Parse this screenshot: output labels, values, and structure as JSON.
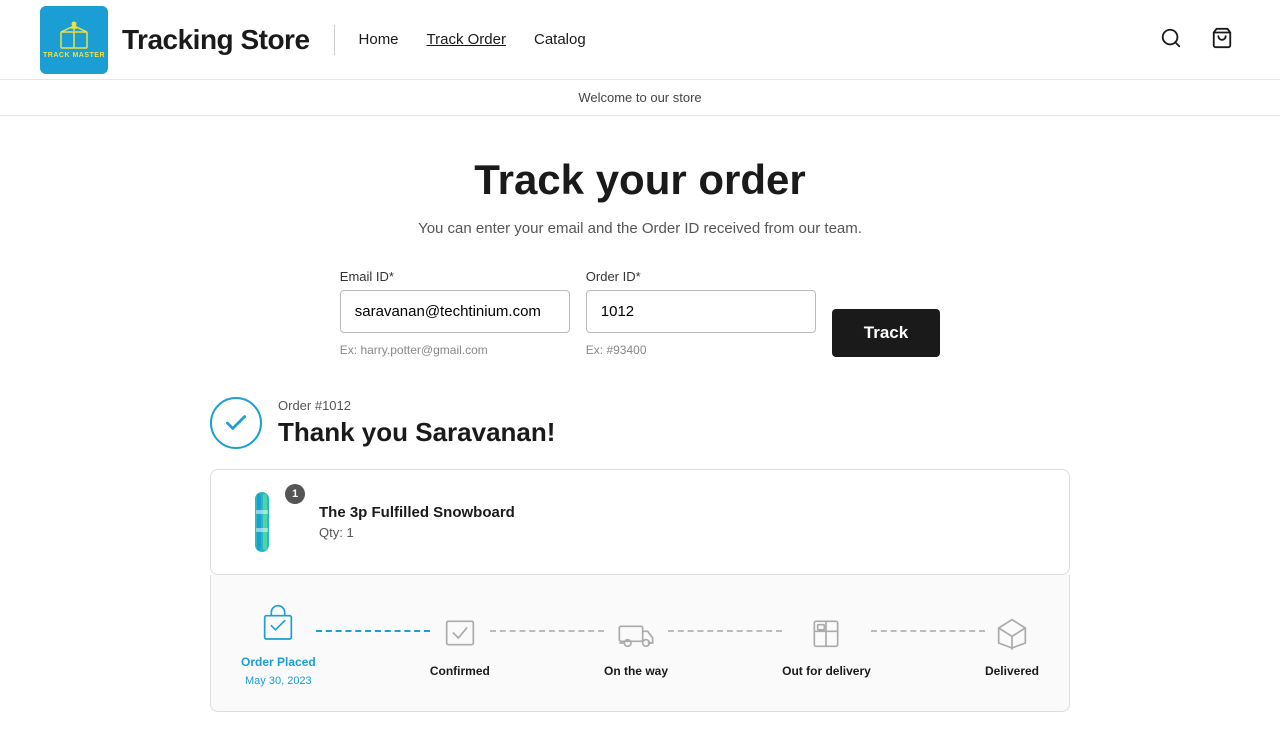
{
  "header": {
    "logo_label": "TRACK MASTER",
    "site_title": "Tracking Store",
    "nav": [
      {
        "label": "Home",
        "active": false
      },
      {
        "label": "Track Order",
        "active": true
      },
      {
        "label": "Catalog",
        "active": false
      }
    ]
  },
  "announcement": {
    "text": "Welcome to our store"
  },
  "main": {
    "page_title": "Track your order",
    "page_subtitle": "You can enter your email and the Order ID received from our team.",
    "form": {
      "email_label": "Email ID*",
      "email_value": "saravanan@techtinium.com",
      "email_hint": "Ex: harry.potter@gmail.com",
      "order_label": "Order ID*",
      "order_value": "1012",
      "order_hint": "Ex: #93400",
      "track_button": "Track"
    },
    "order_result": {
      "order_number": "Order #1012",
      "thank_you": "Thank you Saravanan!",
      "product": {
        "name": "The 3p Fulfilled Snowboard",
        "qty_label": "Qty: 1",
        "qty_badge": "1"
      },
      "timeline": [
        {
          "id": "placed",
          "label": "Order Placed",
          "date": "May 30, 2023",
          "active": true
        },
        {
          "id": "confirmed",
          "label": "Confirmed",
          "date": "",
          "active": false
        },
        {
          "id": "on_way",
          "label": "On the way",
          "date": "",
          "active": false
        },
        {
          "id": "out_delivery",
          "label": "Out for delivery",
          "date": "",
          "active": false
        },
        {
          "id": "delivered",
          "label": "Delivered",
          "date": "",
          "active": false
        }
      ]
    }
  }
}
